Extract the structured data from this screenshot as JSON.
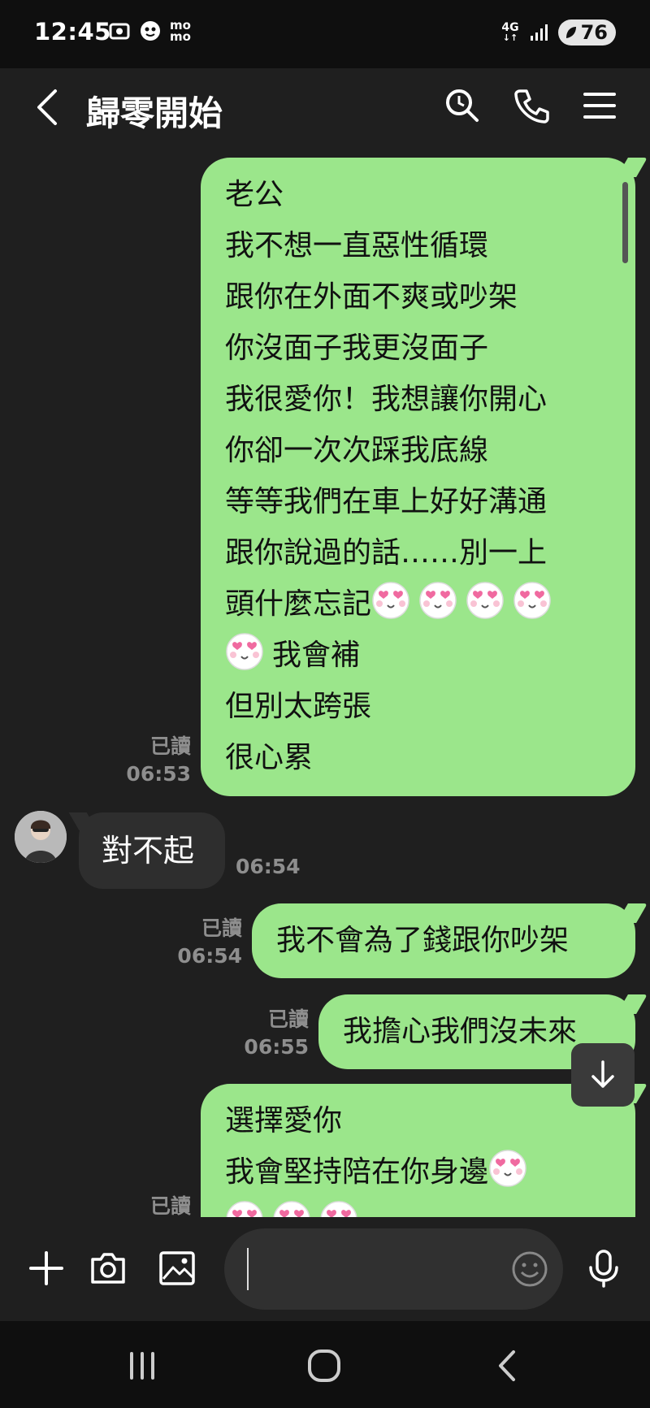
{
  "status_bar": {
    "time": "12:45",
    "momo_label_top": "mo",
    "momo_label_bottom": "mo",
    "network": "4G",
    "battery": "76"
  },
  "header": {
    "title": "歸零開始"
  },
  "messages": {
    "m1": {
      "lines": [
        "老公",
        "我不想一直惡性循環",
        "跟你在外面不爽或吵架",
        "你沒面子我更沒面子",
        "我很愛你！我想讓你開心",
        "你卻一次次踩我底線",
        "等等我們在車上好好溝通",
        "跟你說過的話……別一上",
        "頭什麼忘記",
        "我會補",
        "但別太跨張",
        "很心累"
      ],
      "read": "已讀",
      "time": "06:53"
    },
    "m2": {
      "text": "對不起",
      "time": "06:54"
    },
    "m3": {
      "text": "我不會為了錢跟你吵架",
      "read": "已讀",
      "time": "06:54"
    },
    "m4": {
      "text": "我擔心我們沒未來",
      "read": "已讀",
      "time": "06:55"
    },
    "m5": {
      "lines": [
        "選擇愛你",
        "我會堅持陪在你身邊"
      ],
      "read": "已讀"
    }
  },
  "icons": {
    "emoji": "heart-eyes-face-icon",
    "accent_green": "#9be68b"
  }
}
